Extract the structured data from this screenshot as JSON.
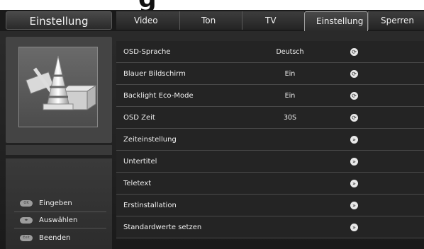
{
  "header": {
    "title": "Einstellung",
    "tabs": [
      {
        "label": "Video"
      },
      {
        "label": "Ton"
      },
      {
        "label": "TV"
      },
      {
        "label": "Einstellung",
        "active": true
      },
      {
        "label": "Sperren"
      }
    ]
  },
  "settings": [
    {
      "label": "OSD-Sprache",
      "value": "Deutsch",
      "control": "cycle-icon"
    },
    {
      "label": "Blauer Bildschirm",
      "value": "Ein",
      "control": "cycle-icon"
    },
    {
      "label": "Backlight Eco-Mode",
      "value": "Ein",
      "control": "cycle-icon"
    },
    {
      "label": "OSD Zeit",
      "value": "30S",
      "control": "cycle-icon"
    },
    {
      "label": "Zeiteinstellung",
      "value": "",
      "control": "enter-icon"
    },
    {
      "label": "Untertitel",
      "value": "",
      "control": "enter-icon"
    },
    {
      "label": "Teletext",
      "value": "",
      "control": "enter-icon"
    },
    {
      "label": "Erstinstallation",
      "value": "",
      "control": "enter-icon"
    },
    {
      "label": "Standardwerte setzen",
      "value": "",
      "control": "enter-icon"
    }
  ],
  "help": [
    {
      "key": "OK",
      "label": "Eingeben"
    },
    {
      "key": "◂▸",
      "label": "Auswählen"
    },
    {
      "key": "Exit",
      "label": "Beenden"
    }
  ],
  "colors": {
    "panel": "#242424",
    "header": "#1a1a1a",
    "text": "#f0f0f0",
    "accent": "#e8e8e8"
  }
}
